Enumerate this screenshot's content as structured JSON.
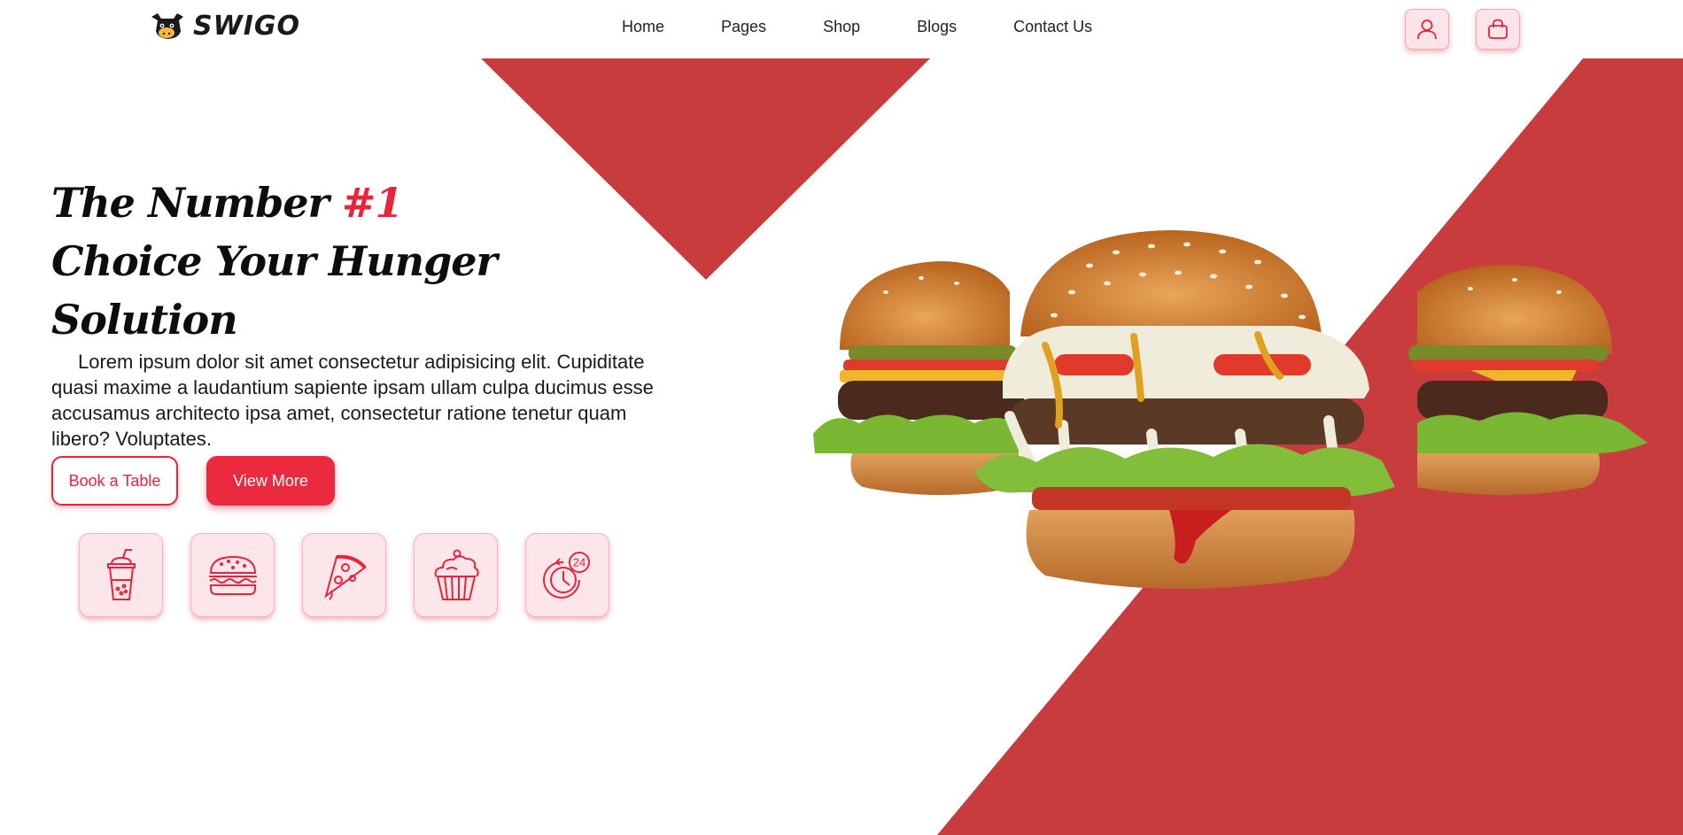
{
  "brand": {
    "name": "SWIGO",
    "logo_icon": "cow-logo-icon"
  },
  "nav": {
    "items": [
      {
        "label": "Home"
      },
      {
        "label": "Pages"
      },
      {
        "label": "Shop"
      },
      {
        "label": "Blogs"
      },
      {
        "label": "Contact Us"
      }
    ]
  },
  "header_actions": {
    "user_icon": "user-icon",
    "cart_icon": "shopping-bag-icon"
  },
  "hero": {
    "title_line1": "The Number ",
    "title_accent": "#1",
    "title_line2": "Choice Your Hunger",
    "title_line3": "Solution",
    "description": "Lorem ipsum dolor sit amet consectetur adipisicing elit. Cupiditate quasi maxime a laudantium sapiente ipsam ullam culpa ducimus esse accusamus architecto ipsa amet, consectetur ratione tenetur quam libero? Voluptates.",
    "book_label": "Book a Table",
    "view_more_label": "View More"
  },
  "categories": [
    {
      "icon": "drink-cup-icon"
    },
    {
      "icon": "burger-icon"
    },
    {
      "icon": "pizza-slice-icon"
    },
    {
      "icon": "cupcake-icon"
    },
    {
      "icon": "clock-24-icon",
      "badge": "24"
    }
  ],
  "colors": {
    "accent": "#e8233a",
    "background_red": "#c83c3e",
    "button_bg": "#fde4e8"
  }
}
